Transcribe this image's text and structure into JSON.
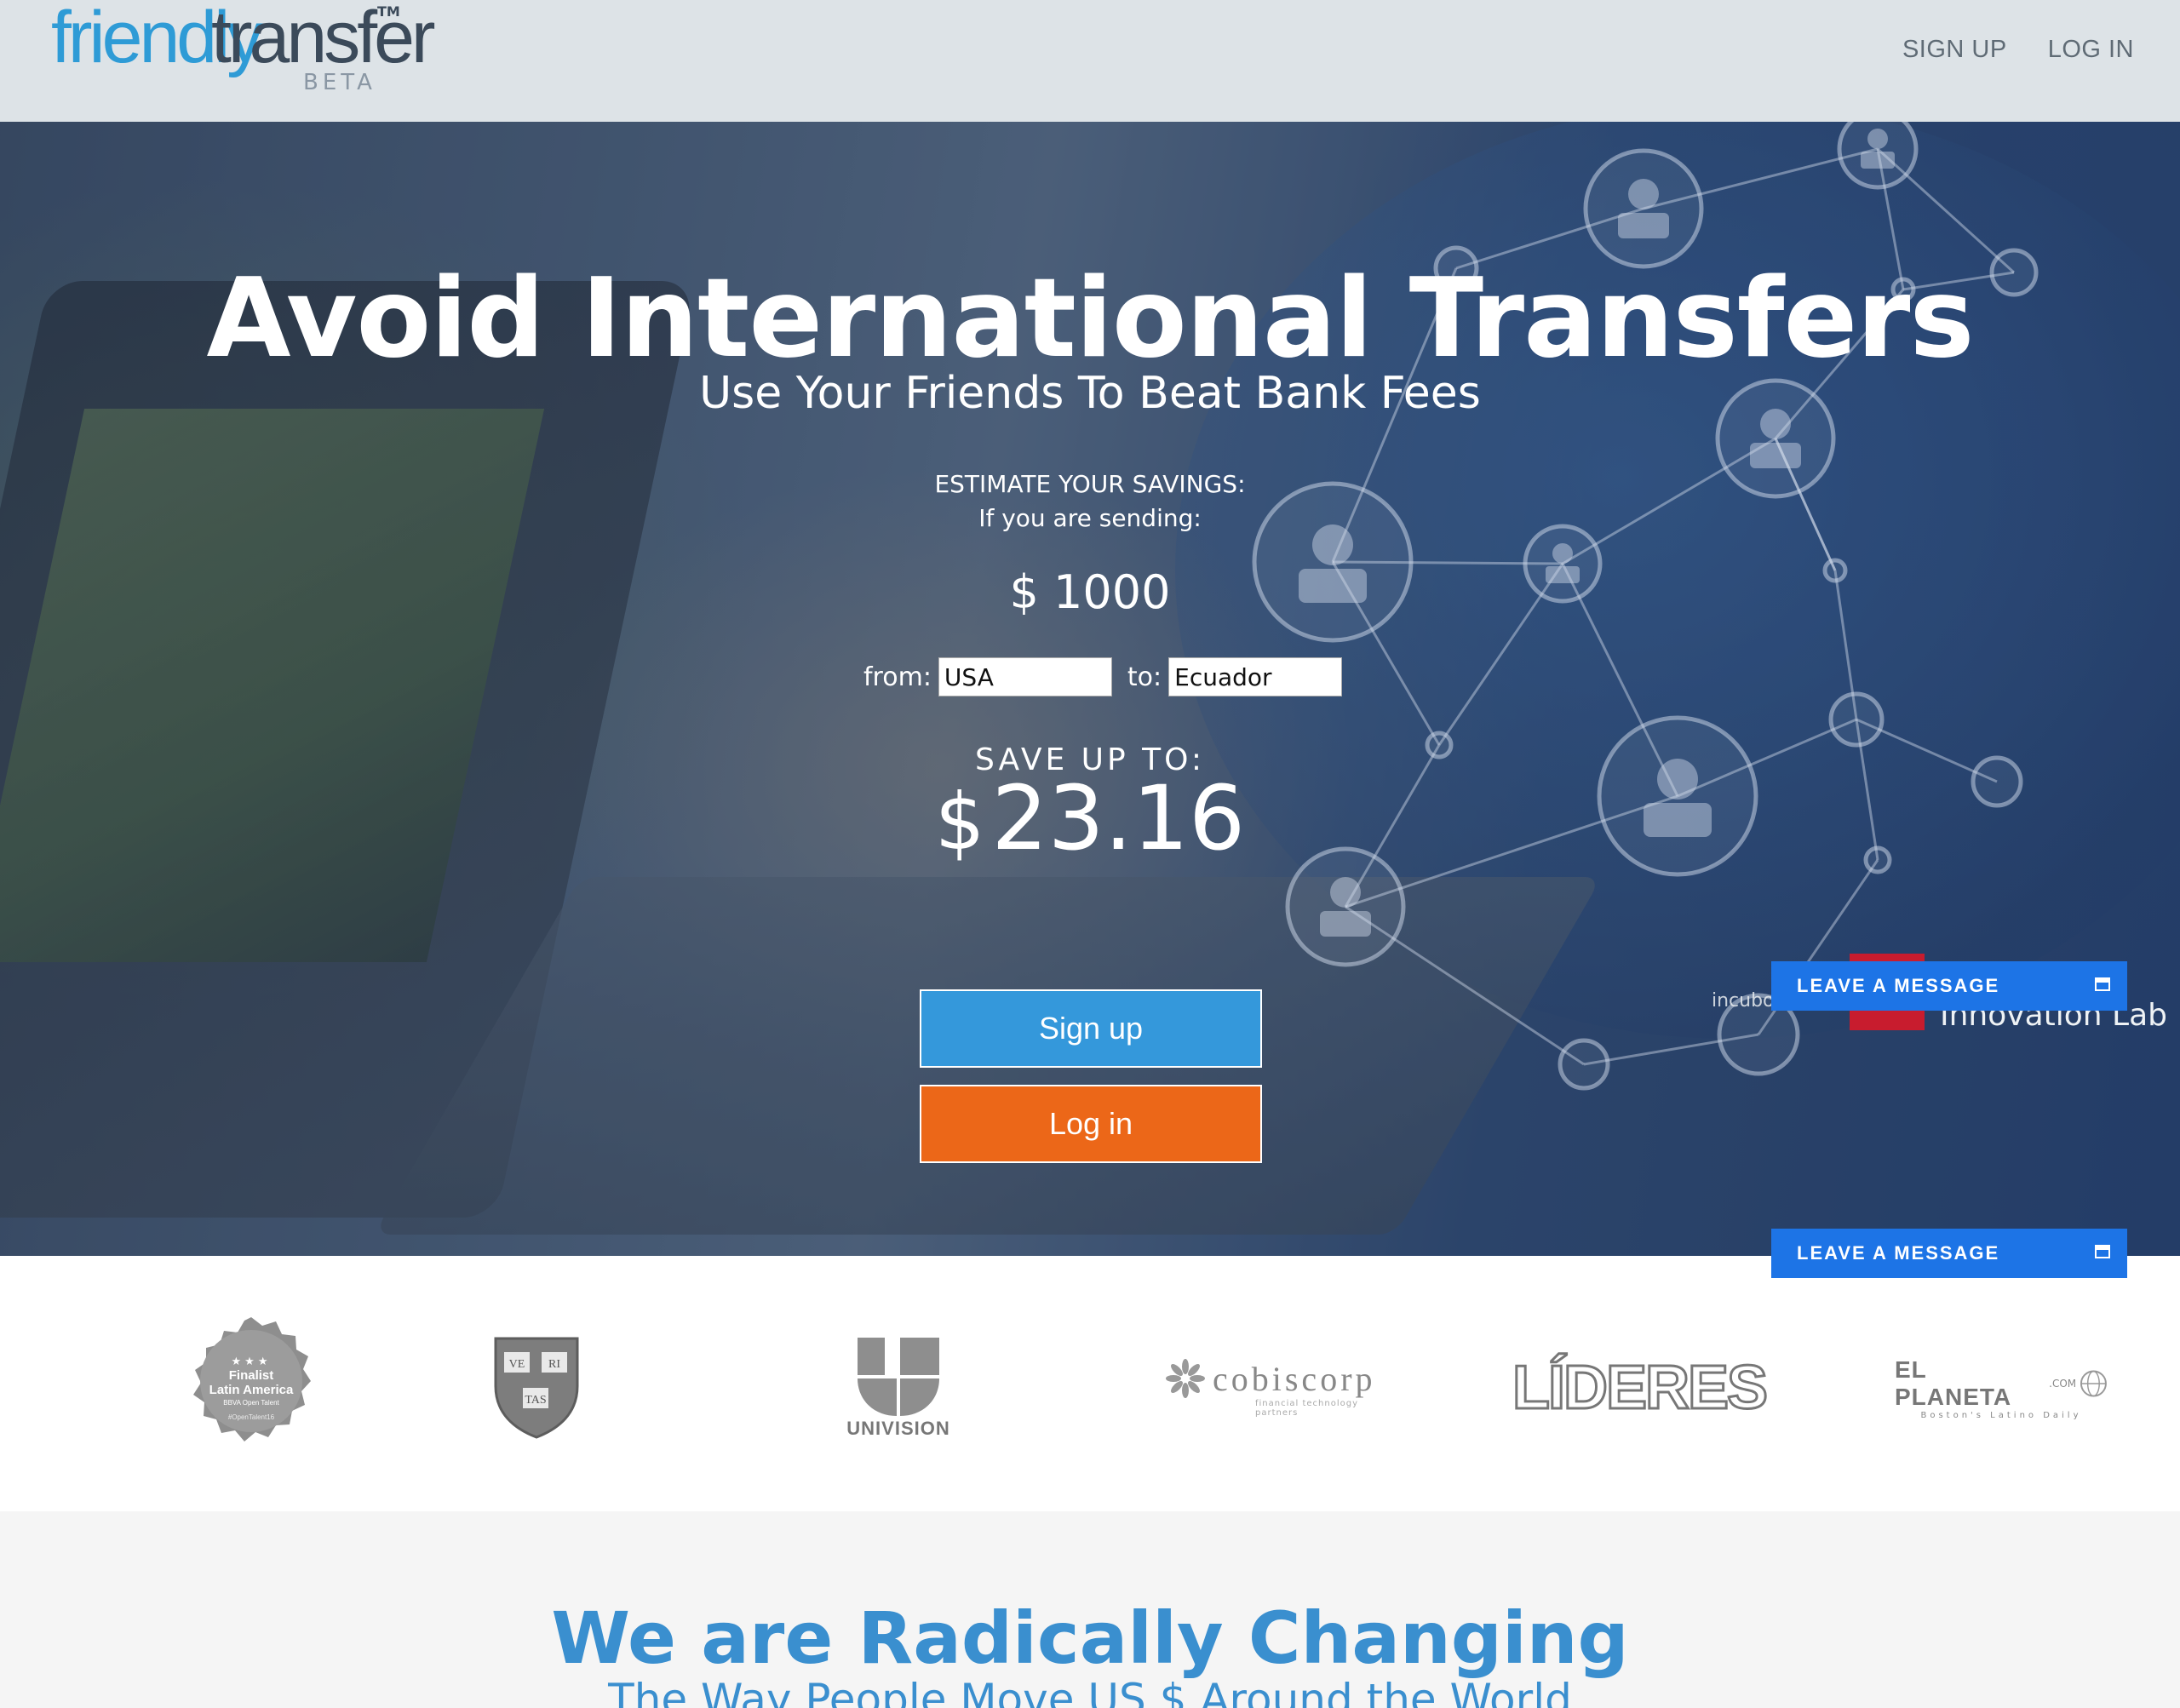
{
  "header": {
    "logo": {
      "word1": "friendly",
      "word2": "transfer",
      "tm": "TM",
      "beta": "BETA"
    },
    "nav": {
      "signup": "SIGN UP",
      "login": "LOG IN"
    }
  },
  "hero": {
    "title": "Avoid International Transfers",
    "subtitle": "Use Your Friends To Beat Bank Fees",
    "estimate_title": "ESTIMATE YOUR SAVINGS:",
    "estimate_sub": "If you are sending:",
    "amount": "$ 1000",
    "from_label": "from:",
    "from_value": "USA",
    "to_label": "to:",
    "to_value": "Ecuador",
    "save_label": "SAVE UP TO:",
    "save_currency": "$",
    "save_value": "23.16",
    "signup_button": "Sign up",
    "login_button": "Log in",
    "partner_incub": "incubo",
    "partner_innovation": "Innovation Lab"
  },
  "chat": {
    "leave_message_1": "LEAVE A MESSAGE",
    "leave_message_2": "LEAVE A MESSAGE"
  },
  "logos": {
    "badge_title": "Finalist",
    "badge_subtitle": "Latin America",
    "badge_small": "BBVA Open Talent",
    "badge_tag": "#OpenTalent16",
    "veritas": [
      "VE",
      "RI",
      "TAS"
    ],
    "univision": "UNIVISION",
    "cobiscorp": "cobiscorp",
    "cobiscorp_sub": "financial technology partners",
    "lideres": "LÍDERES",
    "planeta": "EL PLANETA",
    "planeta_com": ".COM",
    "planeta_sub": "Boston's Latino Daily"
  },
  "section": {
    "title": "We are Radically Changing",
    "subtitle": "The Way People Move US $ Around the World"
  },
  "colors": {
    "brand_blue": "#2e9bd6",
    "signup_blue": "#3498db",
    "login_orange": "#ec6718",
    "chat_blue": "#1d74e6",
    "section_blue": "#3a8fcf"
  }
}
